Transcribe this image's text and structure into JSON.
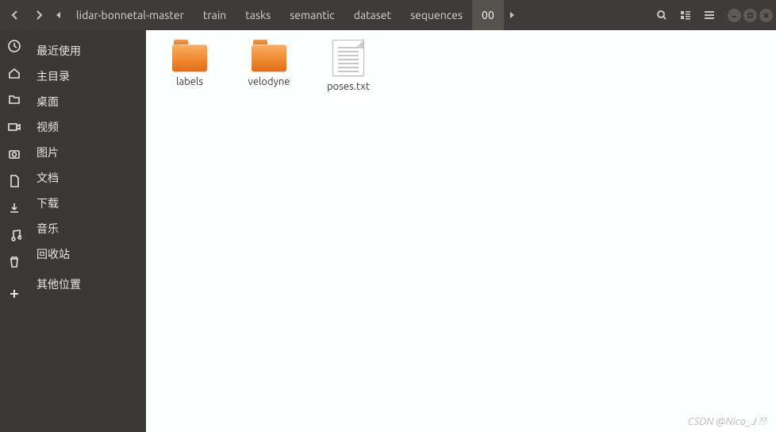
{
  "breadcrumbs": {
    "items": [
      {
        "label": "lidar-bonnetal-master"
      },
      {
        "label": "train"
      },
      {
        "label": "tasks"
      },
      {
        "label": "semantic"
      },
      {
        "label": "dataset"
      },
      {
        "label": "sequences"
      },
      {
        "label": "00"
      }
    ],
    "active_index": 6
  },
  "sidebar": {
    "items": [
      {
        "label": "最近使用"
      },
      {
        "label": "主目录"
      },
      {
        "label": "桌面"
      },
      {
        "label": "视频"
      },
      {
        "label": "图片"
      },
      {
        "label": "文档"
      },
      {
        "label": "下载"
      },
      {
        "label": "音乐"
      },
      {
        "label": "回收站"
      },
      {
        "label": "其他位置"
      }
    ]
  },
  "content": {
    "items": [
      {
        "type": "folder",
        "label": "labels"
      },
      {
        "type": "folder",
        "label": "velodyne"
      },
      {
        "type": "file",
        "label": "poses.txt"
      }
    ]
  },
  "watermark": "CSDN @Nico_J  ??"
}
